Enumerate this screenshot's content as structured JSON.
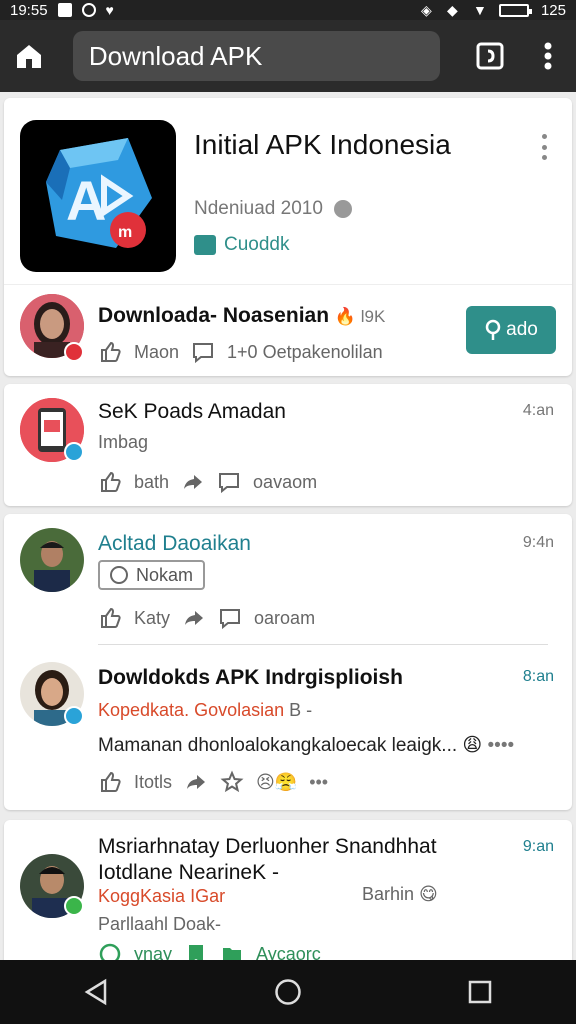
{
  "status_bar": {
    "time": "19:55",
    "battery": "125"
  },
  "toolbar": {
    "url_text": "Download APK"
  },
  "app_card": {
    "title": "Initial APK Indonesia",
    "subtitle": "Ndeniuad 2010",
    "badge_label": "Cuoddk"
  },
  "posts": [
    {
      "title": "Downloada- Noasenian",
      "reaction_text": "🔥 l9K",
      "button_label": "ado",
      "actions": [
        "Maon",
        "1+0 Oetpakenolilan"
      ]
    },
    {
      "title": "SeK Poads Amadan",
      "subtitle": "Imbag",
      "time": "4:an",
      "actions": [
        "bath",
        "oavaom"
      ]
    },
    {
      "title": "Acltad Daoaikan",
      "chip": "Nokam",
      "time": "9:4n",
      "actions": [
        "Katy",
        "oaroam"
      ]
    },
    {
      "title": "Dowldokds APK Indrgisplioish",
      "red_line": "Kopedkata. Govolasian",
      "red_suffix": "B -",
      "body": "Mamanan dhonloalokangkaloecak leaigk...",
      "time": "8:an",
      "actions": [
        "Itotls"
      ]
    },
    {
      "title_line1": "Msriarhnatay Derluonher Snandhhat",
      "title_line2": "Iotdlane NearineK -",
      "red_line": "KoggKasia IGar",
      "right_label": "Barhin",
      "gray_line": "Parllaahl Doak-",
      "time": "9:an",
      "actions": [
        "ynay",
        "Aycaorc"
      ]
    }
  ]
}
